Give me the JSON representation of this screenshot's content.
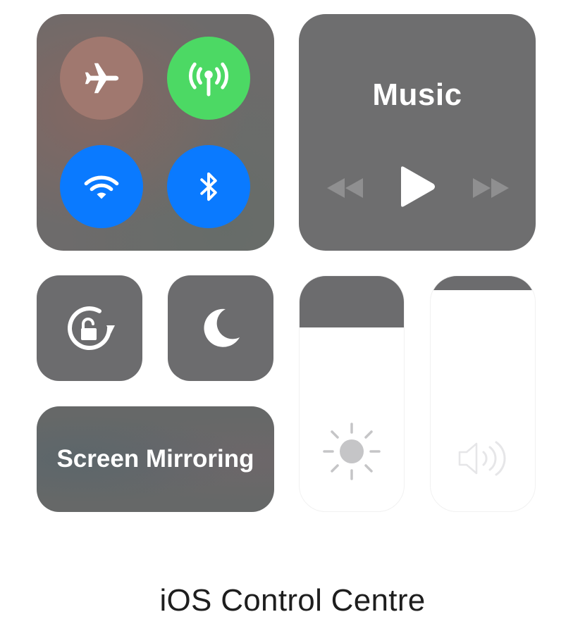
{
  "connectivity": {
    "airplane_mode": {
      "state": "off",
      "color": "#a0786f"
    },
    "cellular_data": {
      "state": "on",
      "color": "#4cd964"
    },
    "wifi": {
      "state": "on",
      "color": "#0a7aff"
    },
    "bluetooth": {
      "state": "on",
      "color": "#0a7aff"
    }
  },
  "music": {
    "title": "Music"
  },
  "screen_mirroring": {
    "label": "Screen Mirroring"
  },
  "brightness": {
    "level": 0.78
  },
  "volume": {
    "level": 0.94
  },
  "caption": "iOS Control Centre"
}
